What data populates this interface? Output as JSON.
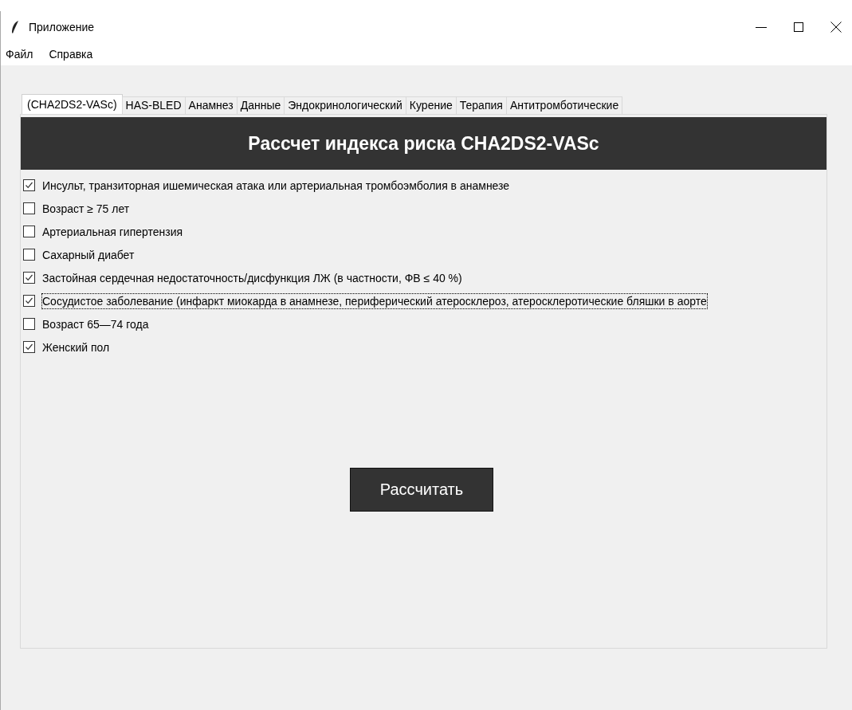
{
  "window": {
    "title": "Приложение"
  },
  "menu": [
    "Файл",
    "Справка"
  ],
  "tabs": [
    {
      "label": "(CHA2DS2-VASc)",
      "selected": true
    },
    {
      "label": "HAS-BLED",
      "selected": false
    },
    {
      "label": "Анамнез",
      "selected": false
    },
    {
      "label": "Данные",
      "selected": false
    },
    {
      "label": "Эндокринологический",
      "selected": false
    },
    {
      "label": "Курение",
      "selected": false
    },
    {
      "label": "Терапия",
      "selected": false
    },
    {
      "label": "Антитромботические",
      "selected": false
    }
  ],
  "header": "Рассчет индекса риска CHA2DS2-VASc",
  "criteria": [
    {
      "label": "Инсульт, транзиторная ишемическая атака или артериальная тромбоэмболия в анамнезе",
      "checked": true,
      "focused": false
    },
    {
      "label": "Возраст ≥ 75 лет",
      "checked": false,
      "focused": false
    },
    {
      "label": "Артериальная гипертензия",
      "checked": false,
      "focused": false
    },
    {
      "label": "Сахарный диабет",
      "checked": false,
      "focused": false
    },
    {
      "label": "Застойная сердечная недостаточность/дисфункция ЛЖ (в частности, ФВ ≤ 40 %)",
      "checked": true,
      "focused": false
    },
    {
      "label": "Сосудистое заболевание (инфаркт миокарда в анамнезе, периферический атеросклероз, атеросклеротические бляшки в аорте",
      "checked": true,
      "focused": true
    },
    {
      "label": "Возраст 65—74 года",
      "checked": false,
      "focused": false
    },
    {
      "label": "Женский пол",
      "checked": true,
      "focused": false
    }
  ],
  "button": "Рассчитать"
}
